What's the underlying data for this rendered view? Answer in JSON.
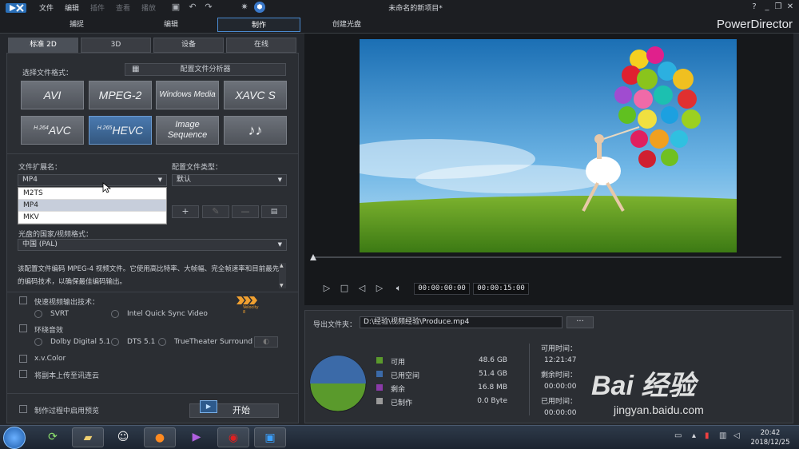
{
  "titlebar": {
    "menus": [
      "文件",
      "编辑",
      "插件",
      "查看",
      "播放"
    ],
    "title": "未命名的新项目*",
    "help": "?",
    "icons": [
      "save-icon",
      "undo-icon",
      "redo-icon",
      "settings-icon",
      "notification-icon"
    ]
  },
  "modes": {
    "tabs": [
      "捕捉",
      "编辑",
      "制作",
      "创建光盘"
    ],
    "active": "制作",
    "brand": "PowerDirector"
  },
  "subtabs": {
    "items": [
      "标准 2D",
      "3D",
      "设备",
      "在线"
    ],
    "active": "标准 2D"
  },
  "format": {
    "select_label": "选择文件格式：",
    "analyzer_button": "配置文件分析器",
    "buttons": [
      {
        "label": "AVI"
      },
      {
        "label": "MPEG-2"
      },
      {
        "label": "Windows Media"
      },
      {
        "label": "XAVC S"
      },
      {
        "sup": "H.264",
        "label": "AVC"
      },
      {
        "sup": "H.265",
        "label": "HEVC"
      },
      {
        "label": "Image Sequence"
      },
      {
        "label": "♪♪"
      }
    ],
    "selected": "HEVC"
  },
  "extension": {
    "label": "文件扩展名：",
    "value": "MP4",
    "options": [
      "M2TS",
      "MP4",
      "MKV"
    ],
    "highlighted": "MP4"
  },
  "profile": {
    "label": "配置文件类型：",
    "value": "默认"
  },
  "region": {
    "label": "光盘的国家/视频格式：",
    "value": "中国 (PAL)"
  },
  "description": "该配置文件编码 MPEG-4 视频文件。它使用高比特率、大帧幅、完全帧速率和目前最先进的编码技术，以确保最佳编码输出。",
  "fast_render": {
    "label": "快速视频输出技术：",
    "options": [
      "SVRT",
      "Intel Quick Sync Video"
    ],
    "badge": "Velocity 8"
  },
  "surround": {
    "label": "环绕音效",
    "options": [
      "Dolby Digital 5.1",
      "DTS 5.1",
      "TrueTheater Surround"
    ]
  },
  "xvcolor": "x.v.Color",
  "upload": "将副本上传至讯连云",
  "preview_during": "制作过程中启用预览",
  "start_button": "开始",
  "player": {
    "current_time": "00:00:00:00",
    "duration": "00:00:15:00",
    "position_fraction": 0.0
  },
  "export": {
    "folder_label": "导出文件夹：",
    "path": "D:\\经验\\视频经验\\Produce.mp4",
    "browse": "···",
    "legend": [
      {
        "label": "可用",
        "value": "48.6  GB",
        "color": "#5a9a2c"
      },
      {
        "label": "已用空间",
        "value": "51.4  GB",
        "color": "#3b6aa8"
      },
      {
        "label": "剩余",
        "value": "16.8  MB",
        "color": "#8a3aa8"
      },
      {
        "label": "已制作",
        "value": "0.0  Byte",
        "color": "#9a9a9a"
      }
    ],
    "pie_used_fraction": 0.514,
    "times": [
      {
        "label": "可用时间：",
        "value": "12:21:47"
      },
      {
        "label": "剩余时间：",
        "value": "00:00:00"
      },
      {
        "label": "已用时间：",
        "value": "00:00:00"
      }
    ]
  },
  "taskbar": {
    "clock_time": "20:42",
    "clock_date": "2018/12/25",
    "apps": [
      "sync-icon",
      "folder-icon",
      "qq-icon",
      "firefox-icon",
      "media-icon",
      "record-icon",
      "powerdirector-icon"
    ]
  },
  "watermark": {
    "main": "Bai 经验",
    "sub": "jingyan.baidu.com"
  }
}
